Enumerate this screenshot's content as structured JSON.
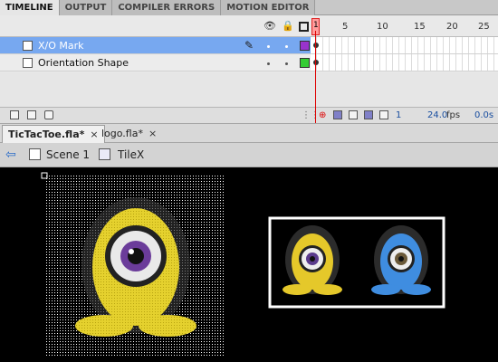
{
  "panel_tabs": [
    "TIMELINE",
    "OUTPUT",
    "COMPILER ERRORS",
    "MOTION EDITOR"
  ],
  "ruler": {
    "current": "1",
    "ticks": [
      "5",
      "10",
      "15",
      "20",
      "25"
    ]
  },
  "layers": [
    {
      "name": "X/O Mark",
      "color": "#9933cc",
      "selected": true
    },
    {
      "name": "Orientation Shape",
      "color": "#33cc33",
      "selected": false
    }
  ],
  "footer": {
    "frame": "1",
    "fps": "24.0",
    "fps_unit": "fps",
    "time": "0.0s"
  },
  "doc_tabs": [
    {
      "label": "TicTacToe.fla*"
    },
    {
      "label": "logo.fla*"
    }
  ],
  "doc_close": "×",
  "breadcrumb": {
    "scene": "Scene 1",
    "symbol": "TileX"
  },
  "colors": {
    "accent": "#2a6cc8",
    "yellow": "#e5d12e",
    "blue": "#3f8de0",
    "stage_bg": "#000000"
  }
}
